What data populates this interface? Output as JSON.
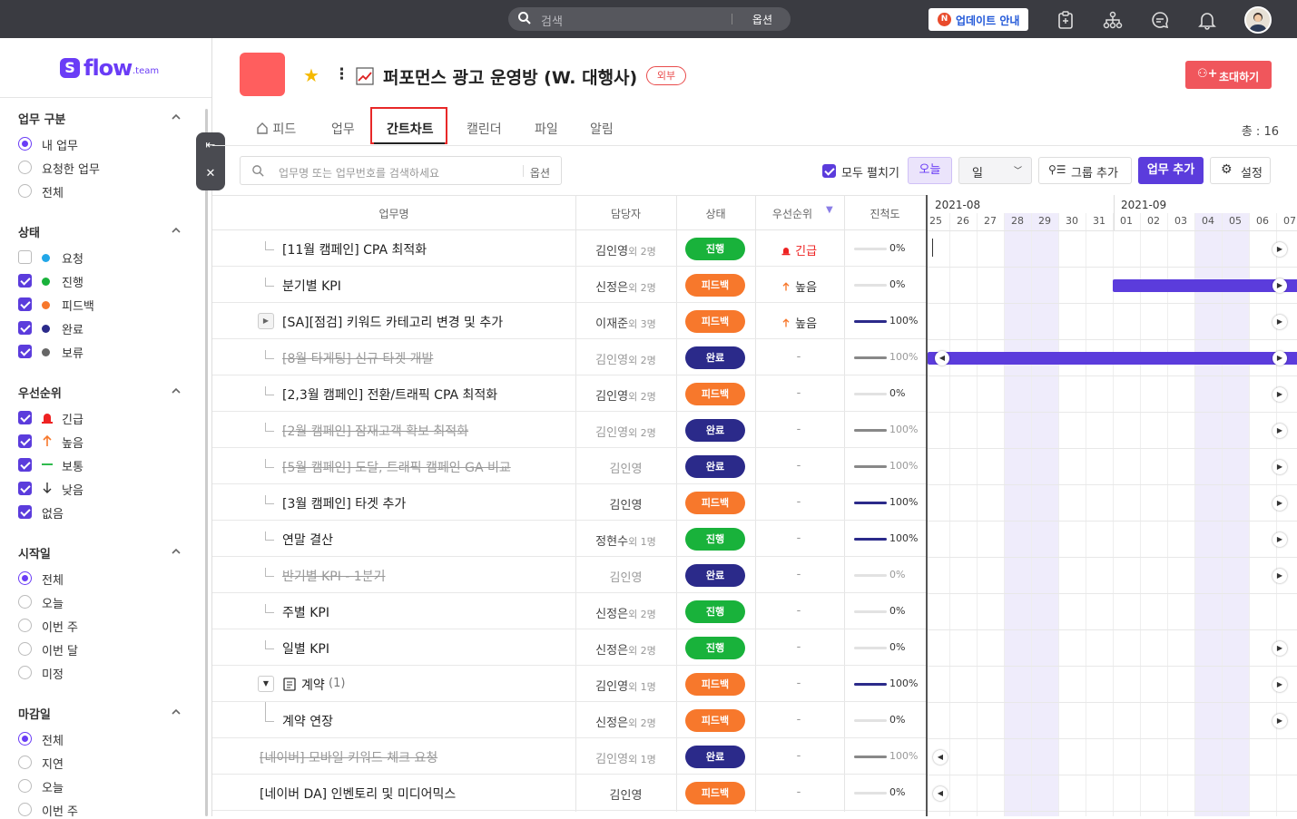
{
  "topbar": {
    "search_placeholder": "검색",
    "search_option": "옵션",
    "update_badge": "N",
    "update_label": "업데이트 안내"
  },
  "brand": {
    "logo_text": "flow",
    "logo_suffix": ".team"
  },
  "sidebar": {
    "sections": [
      {
        "title": "업무 구분",
        "options": [
          {
            "label": "내 업무",
            "selected": true
          },
          {
            "label": "요청한 업무",
            "selected": false
          },
          {
            "label": "전체",
            "selected": false
          }
        ]
      },
      {
        "title": "상태",
        "options": [
          {
            "label": "요청",
            "checked": false,
            "color": "#22a7e8"
          },
          {
            "label": "진행",
            "checked": true,
            "color": "#19b23b"
          },
          {
            "label": "피드백",
            "checked": true,
            "color": "#f7782c"
          },
          {
            "label": "완료",
            "checked": true,
            "color": "#2b2a8a"
          },
          {
            "label": "보류",
            "checked": true,
            "color": "#666666"
          }
        ]
      },
      {
        "title": "우선순위",
        "options": [
          {
            "label": "긴급",
            "checked": true,
            "icon": "siren-icon"
          },
          {
            "label": "높음",
            "checked": true,
            "icon": "arrow-up-icon"
          },
          {
            "label": "보통",
            "checked": true,
            "icon": "dash-icon"
          },
          {
            "label": "낮음",
            "checked": true,
            "icon": "arrow-down-icon"
          },
          {
            "label": "없음",
            "checked": true,
            "icon": ""
          }
        ]
      },
      {
        "title": "시작일",
        "options": [
          {
            "label": "전체",
            "selected": true
          },
          {
            "label": "오늘",
            "selected": false
          },
          {
            "label": "이번 주",
            "selected": false
          },
          {
            "label": "이번 달",
            "selected": false
          },
          {
            "label": "미정",
            "selected": false
          }
        ]
      },
      {
        "title": "마감일",
        "options": [
          {
            "label": "전체",
            "selected": true
          },
          {
            "label": "지연",
            "selected": false
          },
          {
            "label": "오늘",
            "selected": false
          },
          {
            "label": "이번 주",
            "selected": false
          }
        ]
      }
    ]
  },
  "project": {
    "title": "퍼포먼스 광고 운영방 (W. 대행사)",
    "badge": "외부",
    "invite_label": "초대하기",
    "color": "#ff5e5e"
  },
  "tabs": {
    "items": [
      "피드",
      "업무",
      "간트차트",
      "캘린더",
      "파일",
      "알림"
    ],
    "active": "간트차트",
    "total": "총 : 16"
  },
  "toolbar": {
    "search_placeholder": "업무명 또는 업무번호를 검색하세요",
    "search_option": "옵션",
    "expand_all": "모두 펼치기",
    "today": "오늘",
    "unit": "일",
    "group_add": "그룹 추가",
    "task_add": "업무 추가",
    "settings": "설정"
  },
  "table": {
    "headers": {
      "name": "업무명",
      "assignee": "담당자",
      "status": "상태",
      "priority": "우선순위",
      "progress": "진척도"
    },
    "rows": [
      {
        "name": "[11월 캠페인] CPA 최적화",
        "assignee": "김인영",
        "more": "외 2명",
        "status": "진행",
        "priority": "긴급",
        "progress": 0,
        "progress_label": "0%",
        "done": false,
        "level": "child"
      },
      {
        "name": "분기별 KPI",
        "assignee": "신정은",
        "more": "외 2명",
        "status": "피드백",
        "priority": "높음",
        "progress": 0,
        "progress_label": "0%",
        "done": false,
        "level": "child"
      },
      {
        "name": "[SA][점검] 키워드 카테고리 변경 및 추가",
        "assignee": "이재준",
        "more": "외 3명",
        "status": "피드백",
        "priority": "높음",
        "progress": 100,
        "progress_label": "100%",
        "done": false,
        "level": "collapsed"
      },
      {
        "name": "[8월 타게팅] 신규 타겟 개발",
        "assignee": "김인영",
        "more": "외 2명",
        "status": "완료",
        "priority": "-",
        "progress": 100,
        "progress_label": "100%",
        "done": true,
        "level": "child"
      },
      {
        "name": "[2,3월 캠페인] 전환/트래픽 CPA 최적화",
        "assignee": "김인영",
        "more": "외 2명",
        "status": "피드백",
        "priority": "-",
        "progress": 0,
        "progress_label": "0%",
        "done": false,
        "level": "child"
      },
      {
        "name": "[2월 캠페인] 잠재고객 확보 최적화",
        "assignee": "김인영",
        "more": "외 2명",
        "status": "완료",
        "priority": "-",
        "progress": 100,
        "progress_label": "100%",
        "done": true,
        "level": "child"
      },
      {
        "name": "[5월 캠페인] 도달, 트래픽 캠페인 GA 비교",
        "assignee": "김인영",
        "more": "",
        "status": "완료",
        "priority": "-",
        "progress": 100,
        "progress_label": "100%",
        "done": true,
        "level": "child"
      },
      {
        "name": "[3월 캠페인] 타겟 추가",
        "assignee": "김인영",
        "more": "",
        "status": "피드백",
        "priority": "-",
        "progress": 100,
        "progress_label": "100%",
        "done": false,
        "level": "child"
      },
      {
        "name": "연말 결산",
        "assignee": "정현수",
        "more": "외 1명",
        "status": "진행",
        "priority": "-",
        "progress": 100,
        "progress_label": "100%",
        "done": false,
        "level": "child"
      },
      {
        "name": "반기별 KPI - 1분기",
        "assignee": "김인영",
        "more": "",
        "status": "완료",
        "priority": "-",
        "progress": 0,
        "progress_label": "0%",
        "done": true,
        "level": "child"
      },
      {
        "name": "주별 KPI",
        "assignee": "신정은",
        "more": "외 2명",
        "status": "진행",
        "priority": "-",
        "progress": 0,
        "progress_label": "0%",
        "done": false,
        "level": "child"
      },
      {
        "name": "일별 KPI",
        "assignee": "신정은",
        "more": "외 2명",
        "status": "진행",
        "priority": "-",
        "progress": 0,
        "progress_label": "0%",
        "done": false,
        "level": "child"
      },
      {
        "name": "계약",
        "count": "(1)",
        "assignee": "김인영",
        "more": "외 1명",
        "status": "피드백",
        "priority": "-",
        "progress": 100,
        "progress_label": "100%",
        "done": false,
        "level": "expanded"
      },
      {
        "name": "계약 연장",
        "assignee": "신정은",
        "more": "외 2명",
        "status": "피드백",
        "priority": "-",
        "progress": 0,
        "progress_label": "0%",
        "done": false,
        "level": "grandchild"
      },
      {
        "name": "[네이버] 모바일 키워드 체크 요청",
        "assignee": "김인영",
        "more": "외 1명",
        "status": "완료",
        "priority": "-",
        "progress": 100,
        "progress_label": "100%",
        "done": true,
        "level": "root"
      },
      {
        "name": "[네이버 DA] 인벤토리 및 미디어믹스",
        "assignee": "김인영",
        "more": "",
        "status": "피드백",
        "priority": "-",
        "progress": 0,
        "progress_label": "0%",
        "done": false,
        "level": "root"
      }
    ]
  },
  "status_colors": {
    "진행": "#19b23b",
    "피드백": "#f7782c",
    "완료": "#2b2a8a",
    "요청": "#22a7e8",
    "보류": "#666666"
  },
  "gantt": {
    "months": [
      "2021-08",
      "2021-09"
    ],
    "days": [
      "25",
      "26",
      "27",
      "28",
      "29",
      "30",
      "31",
      "01",
      "02",
      "03",
      "04",
      "05",
      "06",
      "07"
    ],
    "weekend_days": [
      "28",
      "29",
      "04",
      "05"
    ],
    "markers": [
      {
        "row": 0,
        "type": "cursor",
        "arrow": "right"
      },
      {
        "row": 1,
        "bar_start": "01",
        "bar_end": "07",
        "arrow": "right"
      },
      {
        "row": 2,
        "arrow": "right"
      },
      {
        "row": 3,
        "bar_start": "25",
        "bar_end": "07",
        "arrow": "both"
      },
      {
        "row": 4,
        "arrow": "right"
      },
      {
        "row": 5,
        "arrow": "right"
      },
      {
        "row": 6,
        "arrow": "right"
      },
      {
        "row": 7,
        "arrow": "right"
      },
      {
        "row": 8,
        "arrow": "right"
      },
      {
        "row": 9,
        "arrow": "right"
      },
      {
        "row": 11,
        "arrow": "right"
      },
      {
        "row": 12,
        "arrow": "right"
      },
      {
        "row": 13,
        "arrow": "right"
      },
      {
        "row": 14,
        "arrow": "left"
      },
      {
        "row": 15,
        "arrow": "left"
      }
    ]
  }
}
